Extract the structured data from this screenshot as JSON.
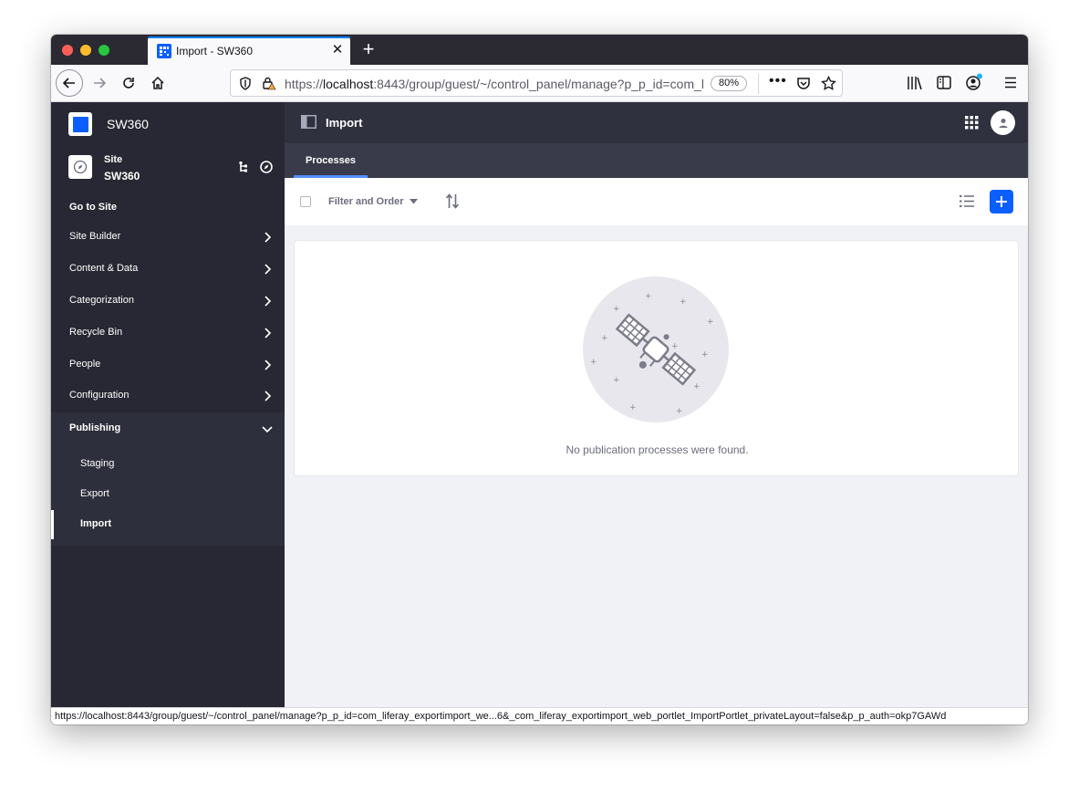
{
  "browser": {
    "tab_title": "Import - SW360",
    "url_prefix": "https://",
    "url_host": "localhost",
    "url_rest": ":8443/group/guest/~/control_panel/manage?p_p_id=com_liferay_exportimport_web_portlet_ImportPortlet",
    "zoom": "80%",
    "status_url": "https://localhost:8443/group/guest/~/control_panel/manage?p_p_id=com_liferay_exportimport_we...6&_com_liferay_exportimport_web_portlet_ImportPortlet_privateLayout=false&p_p_auth=okp7GAWd"
  },
  "sidebar": {
    "app_name": "SW360",
    "site_label": "Site",
    "site_name": "SW360",
    "go_to_site": "Go to Site",
    "items": [
      {
        "label": "Site Builder"
      },
      {
        "label": "Content & Data"
      },
      {
        "label": "Categorization"
      },
      {
        "label": "Recycle Bin"
      },
      {
        "label": "People"
      },
      {
        "label": "Configuration"
      }
    ],
    "publishing": {
      "label": "Publishing",
      "children": [
        {
          "label": "Staging"
        },
        {
          "label": "Export"
        },
        {
          "label": "Import"
        }
      ]
    }
  },
  "header": {
    "title": "Import"
  },
  "tabs": {
    "processes": "Processes"
  },
  "toolbar": {
    "filter_label": "Filter and Order"
  },
  "empty_state": {
    "message": "No publication processes were found."
  },
  "colors": {
    "accent": "#0b5fff",
    "sidebar_bg": "#272833",
    "header_bg": "#30313f",
    "tabstrip_bg": "#393a4a",
    "content_bg": "#f1f2f5"
  }
}
